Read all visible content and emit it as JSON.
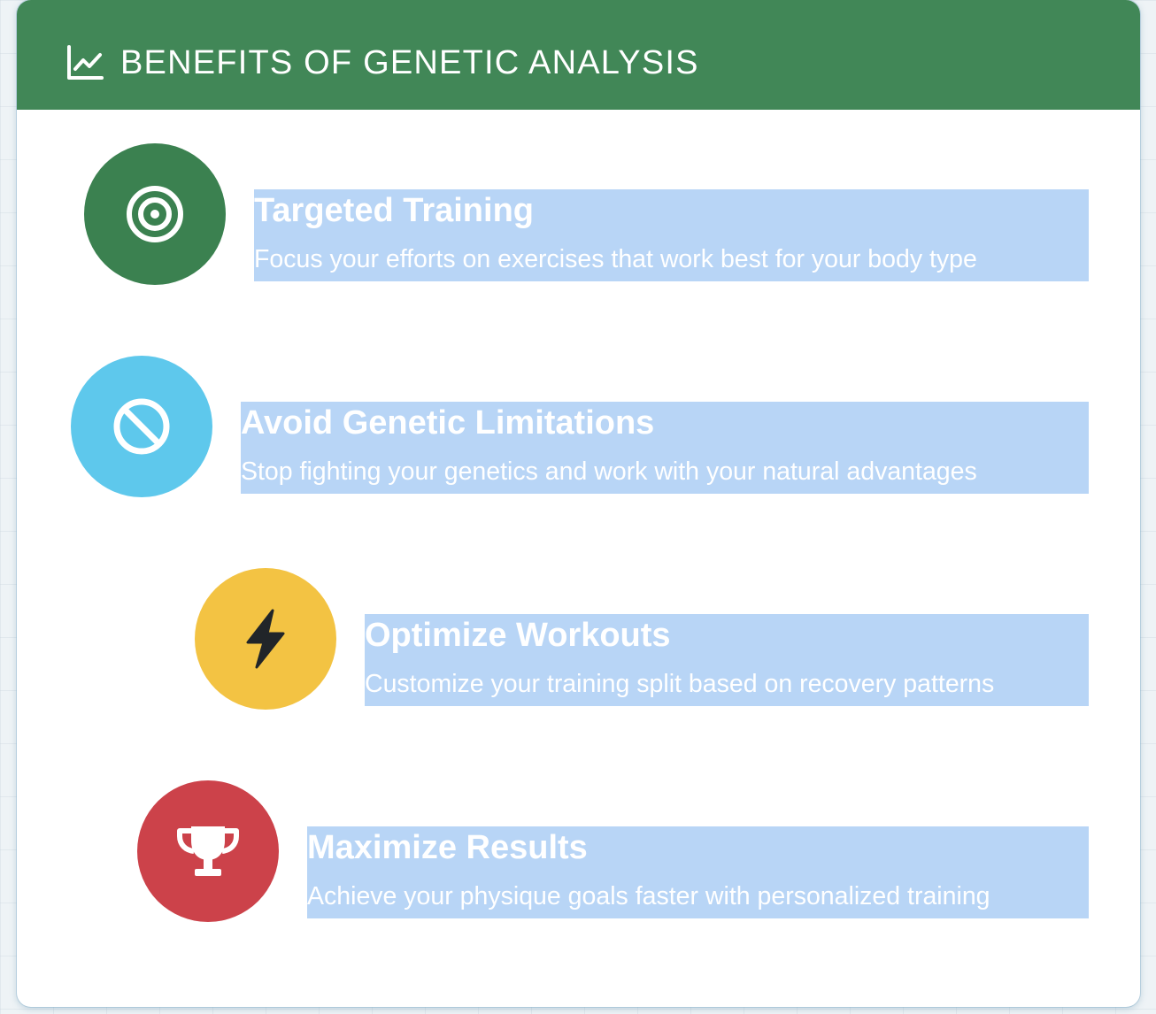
{
  "header": {
    "icon": "chart-line-icon",
    "title": "BENEFITS OF GENETIC ANALYSIS",
    "background": "#418757"
  },
  "benefits": [
    {
      "icon": "target-icon",
      "color": "#3b8150",
      "title": "Targeted Training",
      "description": "Focus your efforts on exercises that work best for your body type"
    },
    {
      "icon": "ban-icon",
      "color": "#5ec8ec",
      "title": "Avoid Genetic Limitations",
      "description": "Stop fighting your genetics and work with your natural advantages"
    },
    {
      "icon": "lightning-icon",
      "color": "#f3c343",
      "title": "Optimize Workouts",
      "description": "Customize your training split based on recovery patterns"
    },
    {
      "icon": "trophy-icon",
      "color": "#cc424a",
      "title": "Maximize Results",
      "description": "Achieve your physique goals faster with personalized training"
    }
  ],
  "selection_highlight": "#b8d5f6"
}
